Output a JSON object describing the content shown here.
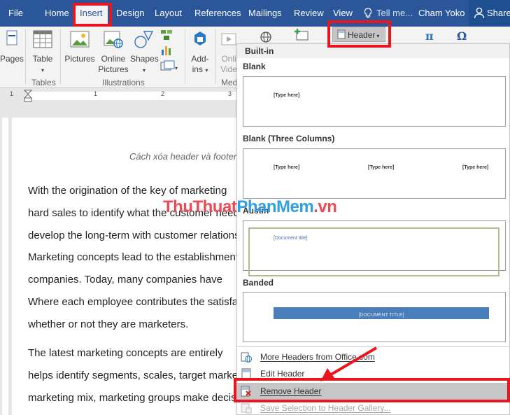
{
  "tabs": [
    {
      "label": "File"
    },
    {
      "label": "Home"
    },
    {
      "label": "Insert"
    },
    {
      "label": "Design"
    },
    {
      "label": "Layout"
    },
    {
      "label": "References"
    },
    {
      "label": "Mailings"
    },
    {
      "label": "Review"
    },
    {
      "label": "View"
    },
    {
      "label": "Tell me..."
    }
  ],
  "user_name": "Cham Yoko",
  "share_label": "Share",
  "ribbon": {
    "pages_label": "Pages",
    "table_label": "Table",
    "pictures_label": "Pictures",
    "online_pictures_label": [
      "Online",
      "Pictures"
    ],
    "shapes_label": "Shapes",
    "addins_label": [
      "Add-",
      "ins"
    ],
    "online_video_label": [
      "Onli",
      "Vide"
    ],
    "header_button_label": "Header",
    "groups": {
      "tables": "Tables",
      "illustrations": "Illustrations",
      "media": "Med"
    }
  },
  "ruler_numbers": [
    "1",
    "1",
    "2",
    "3"
  ],
  "document": {
    "caption": "Cách xóa header và footer",
    "lines": [
      "With the origination of the key of marketing",
      "hard sales to identify what the customer needs,",
      "develop the long-term with customer relations.",
      "Marketing concepts lead to the establishment",
      "companies. Today, many companies have",
      "Where each employee contributes the satisfaction",
      "whether or not they are marketers.",
      "The latest marketing concepts are entirely",
      "helps identify segments, scales, target market,",
      "marketing mix, marketing groups make decisions"
    ]
  },
  "gallery": {
    "section_title": "Built-in",
    "items": [
      {
        "name": "Blank",
        "placeholders": [
          "[Type here]"
        ]
      },
      {
        "name": "Blank (Three Columns)",
        "placeholders": [
          "[Type here]",
          "[Type here]",
          "[Type here]"
        ]
      },
      {
        "name": "Austin",
        "placeholders": [
          "[Document title]"
        ]
      },
      {
        "name": "Banded",
        "placeholders": [
          "[DOCUMENT TITLE]"
        ]
      }
    ]
  },
  "menu": {
    "more_headers": "More Headers from Office.com",
    "edit_header": "Edit Header",
    "remove_header": "Remove Header",
    "save_selection": "Save Selection to Header Gallery..."
  },
  "watermark": {
    "part1": "ThuThuat",
    "part2": "PhanMem",
    "part3": ".vn"
  },
  "colors": {
    "title_bar": "#2b579a",
    "highlight": "#e8161f",
    "banded": "#4a7ebb",
    "austin_border": "#b9b98b"
  }
}
